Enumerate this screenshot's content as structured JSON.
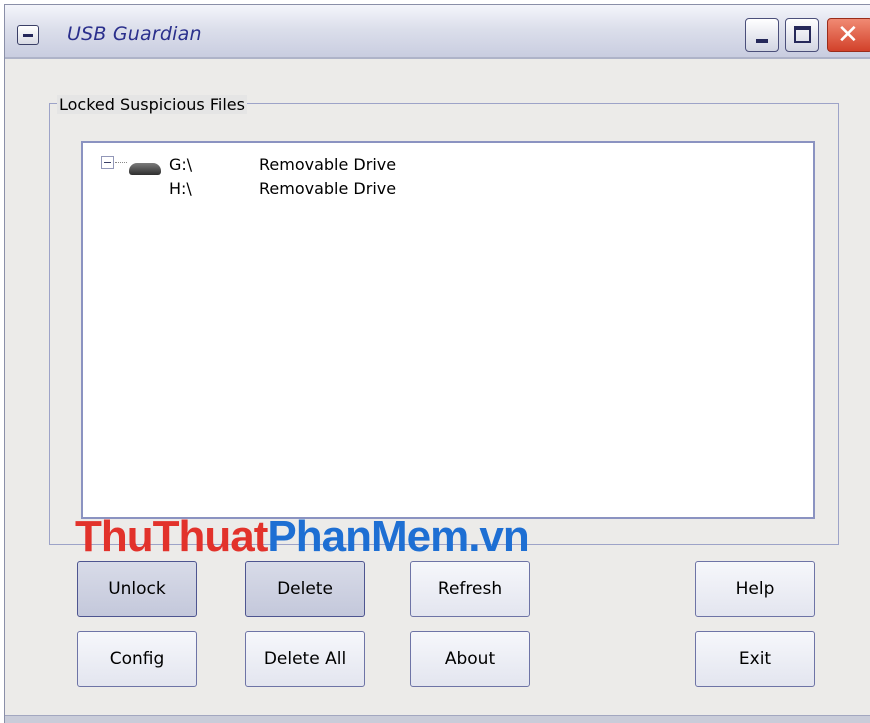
{
  "window": {
    "title": "USB Guardian"
  },
  "locked_group": {
    "label": "Locked Suspicious Files",
    "items": [
      {
        "path": "G:\\",
        "type": "Removable Drive"
      },
      {
        "path": "H:\\",
        "type": "Removable Drive"
      }
    ]
  },
  "watermark": {
    "part1": "ThuThuat",
    "part2": "PhanMem.vn"
  },
  "buttons": {
    "unlock": "Unlock",
    "delete": "Delete",
    "refresh": "Refresh",
    "help": "Help",
    "config": "Config",
    "delete_all": "Delete All",
    "about": "About",
    "exit": "Exit"
  },
  "colors": {
    "accent_title": "#2a2f8c",
    "close_button": "#d2412a",
    "watermark_red": "#e2322b",
    "watermark_blue": "#1e6fd3"
  },
  "icons": {
    "system_menu": "system-menu-icon",
    "minimize": "minimize-icon",
    "maximize": "maximize-icon",
    "close": "close-icon",
    "drive": "drive-icon",
    "tree_toggle": "tree-collapse-icon"
  }
}
